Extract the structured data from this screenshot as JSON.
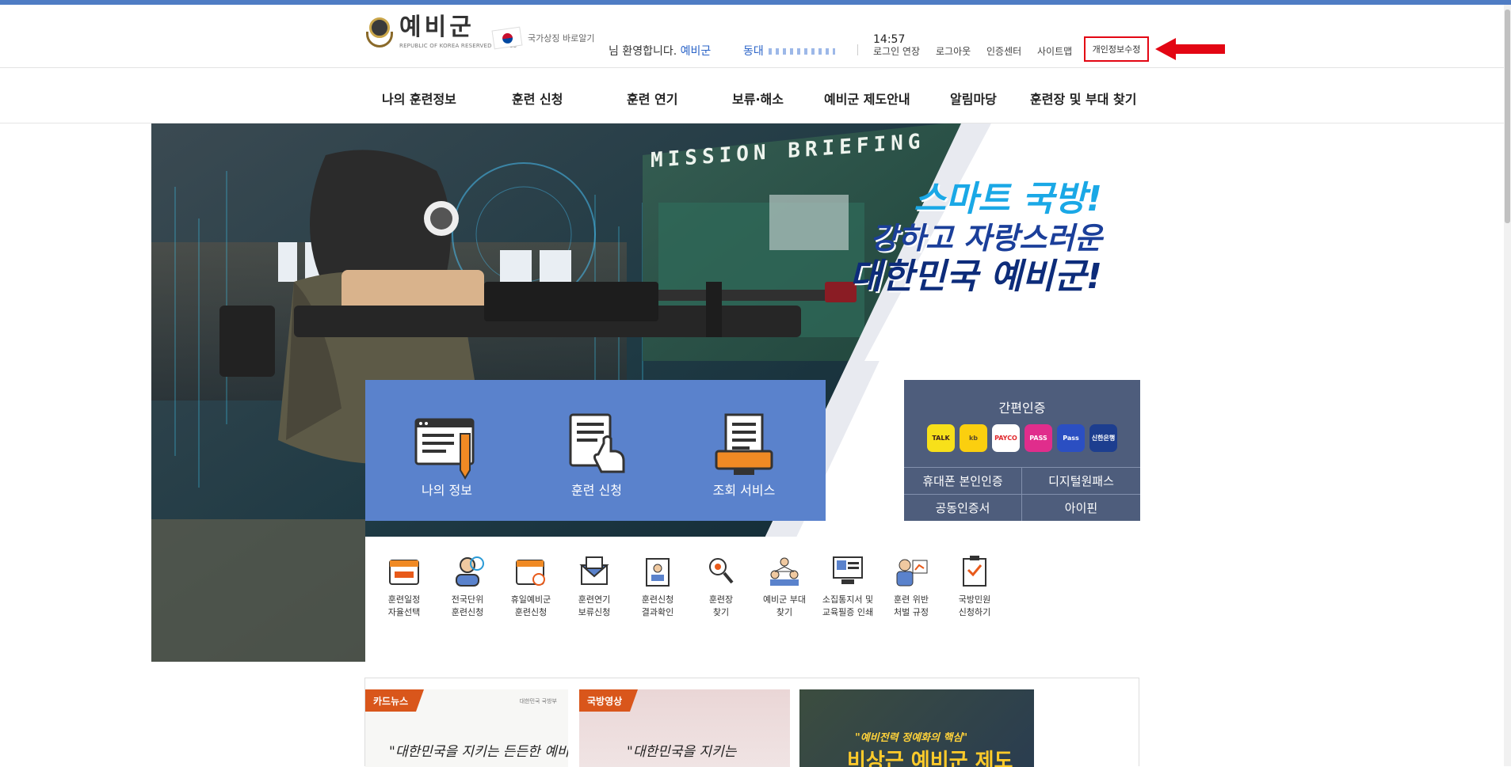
{
  "header": {
    "logo_title": "예비군",
    "logo_subtitle": "REPUBLIC OF KOREA RESERVED FORCES",
    "symbol_link": "국가상징 바로알기",
    "greeting": "님 환영합니다.",
    "greeting_org": "예비군",
    "unit_label": "동대",
    "session_time": "14:57",
    "links": [
      "로그인 연장",
      "로그아웃",
      "인증센터",
      "사이트맵"
    ],
    "privacy_edit": "개인정보수정"
  },
  "nav": {
    "items": [
      "나의 훈련정보",
      "훈련 신청",
      "훈련 연기",
      "보류·해소",
      "예비군 제도안내",
      "알림마당",
      "훈련장 및 부대 찾기"
    ]
  },
  "hero": {
    "mission_sign": "MISSION BRIEFING",
    "slogan_line1": "스마트 국방!",
    "slogan_line2": "강하고 자랑스러운",
    "slogan_line3": "대한민국 예비군!"
  },
  "tiles": [
    {
      "label": "나의 정보",
      "icon": "info-document-icon"
    },
    {
      "label": "훈련 신청",
      "icon": "apply-hand-icon"
    },
    {
      "label": "조회 서비스",
      "icon": "lookup-monitor-icon"
    }
  ],
  "auth": {
    "title": "간편인증",
    "providers": [
      {
        "name": "TALK",
        "bg": "#f7e01a",
        "fg": "#3a1d1d"
      },
      {
        "name": "kb",
        "bg": "#fbcf0f",
        "fg": "#5a4a2a"
      },
      {
        "name": "PAYCO",
        "bg": "#ffffff",
        "fg": "#e0262b"
      },
      {
        "name": "PASS",
        "bg": "#e02d8c",
        "fg": "#ffffff"
      },
      {
        "name": "Pass",
        "bg": "#2b4fc2",
        "fg": "#ffffff"
      },
      {
        "name": "신한은행",
        "bg": "#1d3e8f",
        "fg": "#ffffff"
      }
    ],
    "options": [
      "휴대폰 본인인증",
      "디지털원패스",
      "공동인증서",
      "아이핀"
    ]
  },
  "quick_menu": [
    {
      "label": "훈련일정\n자율선택",
      "icon": "calendar-icon"
    },
    {
      "label": "전국단위\n훈련신청",
      "icon": "person-globe-icon"
    },
    {
      "label": "휴일예비군\n훈련신청",
      "icon": "calendar-search-icon"
    },
    {
      "label": "훈련연기\n보류신청",
      "icon": "envelope-icon"
    },
    {
      "label": "훈련신청\n결과확인",
      "icon": "clipboard-person-icon"
    },
    {
      "label": "훈련장\n찾기",
      "icon": "map-search-icon"
    },
    {
      "label": "예비군 부대\n찾기",
      "icon": "group-icon"
    },
    {
      "label": "소집통지서 및\n교육필증 인쇄",
      "icon": "printer-monitor-icon"
    },
    {
      "label": "훈련 위반\n처벌 규정",
      "icon": "presenter-icon"
    },
    {
      "label": "국방민원\n신청하기",
      "icon": "checklist-icon"
    }
  ],
  "news": {
    "card1_badge": "카드뉴스",
    "card1_text": "\"대한민국을 지키는 든든한 예비군\"",
    "card1_org": "대한민국 국방부",
    "card2_badge": "국방영상",
    "card2_text": "\"대한민국을 지키는",
    "card3_text": "\"예비전력 정예화의 핵심\"",
    "card3_big": "비상근 예비군 제도"
  }
}
